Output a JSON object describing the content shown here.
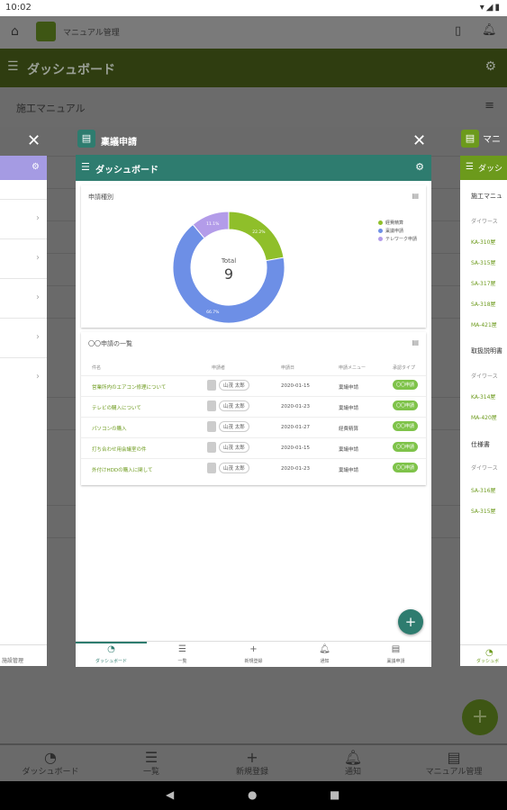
{
  "status_bar": {
    "time": "10:02",
    "icons": "▾◢▮"
  },
  "background_app": {
    "app_title": "マニュアル管理",
    "header_title": "ダッシュボード",
    "section_title": "施工マニュアル",
    "nav": [
      {
        "icon": "dashboard-icon",
        "label": "ダッシュボード"
      },
      {
        "icon": "list-icon",
        "label": "一覧"
      },
      {
        "icon": "add-icon",
        "label": "新規登録"
      },
      {
        "icon": "bell-icon",
        "label": "通知"
      },
      {
        "icon": "manual-icon",
        "label": "マニュアル管理"
      }
    ],
    "fab": "+"
  },
  "recents": {
    "main_card": {
      "app_name": "稟議申請",
      "appbar_title": "ダッシュボード",
      "chart_panel_title": "申請種別",
      "list_panel_title": "〇〇申請の一覧",
      "table_headers": {
        "title": "件名",
        "applicant": "申請者",
        "date": "申請日",
        "menu": "申請メニュー",
        "type": "承認タイプ"
      },
      "rows": [
        {
          "title": "営業所内のエアコン修理について",
          "applicant": "山茂 太郎",
          "date": "2020-01-15",
          "menu": "稟議申請",
          "type": "〇〇申請"
        },
        {
          "title": "テレビの購入について",
          "applicant": "山茂 太郎",
          "date": "2020-01-23",
          "menu": "稟議申請",
          "type": "〇〇申請"
        },
        {
          "title": "パソコンの購入",
          "applicant": "山茂 太郎",
          "date": "2020-01-27",
          "menu": "経費精算",
          "type": "〇〇申請"
        },
        {
          "title": "打ち合わせ用会議室の件",
          "applicant": "山茂 太郎",
          "date": "2020-01-15",
          "menu": "稟議申請",
          "type": "〇〇申請"
        },
        {
          "title": "外付けHDDの購入に関して",
          "applicant": "山茂 太郎",
          "date": "2020-01-23",
          "menu": "稟議申請",
          "type": "〇〇申請"
        }
      ],
      "nav": [
        {
          "icon": "dashboard-icon",
          "label": "ダッシュボード"
        },
        {
          "icon": "list-icon",
          "label": "一覧"
        },
        {
          "icon": "add-icon",
          "label": "新規登録"
        },
        {
          "icon": "bell-icon",
          "label": "通知"
        },
        {
          "icon": "approval-icon",
          "label": "稟議申請"
        }
      ],
      "fab": "+"
    },
    "right_card": {
      "app_name": "マニ",
      "appbar_title": "ダッシ",
      "texts": [
        "施工マニュ",
        "ダイワース",
        "KA-310屋",
        "SA-315屋",
        "SA-317屋",
        "SA-318屋",
        "MA-421屋",
        "取扱説明書",
        "ダイワース",
        "KA-314屋",
        "MA-420屋",
        "仕様書",
        "ダイワース",
        "SA-316屋",
        "SA-315屋"
      ],
      "footer_label": "ダッシュボ"
    },
    "left_card": {
      "footer_label": "施設管理"
    }
  },
  "chart_data": {
    "type": "pie",
    "center_label": "Total",
    "center_value": "9",
    "legend": [
      "経費精算",
      "稟議申請",
      "テレワーク申請"
    ],
    "slices": [
      {
        "name": "経費精算",
        "value": 22.2,
        "label": "22.2%",
        "color": "#8fbf2a"
      },
      {
        "name": "稟議申請",
        "value": 66.7,
        "label": "66.7%",
        "color": "#6d8fe6"
      },
      {
        "name": "テレワーク申請",
        "value": 11.1,
        "label": "11.1%",
        "color": "#b39ce9"
      }
    ]
  }
}
